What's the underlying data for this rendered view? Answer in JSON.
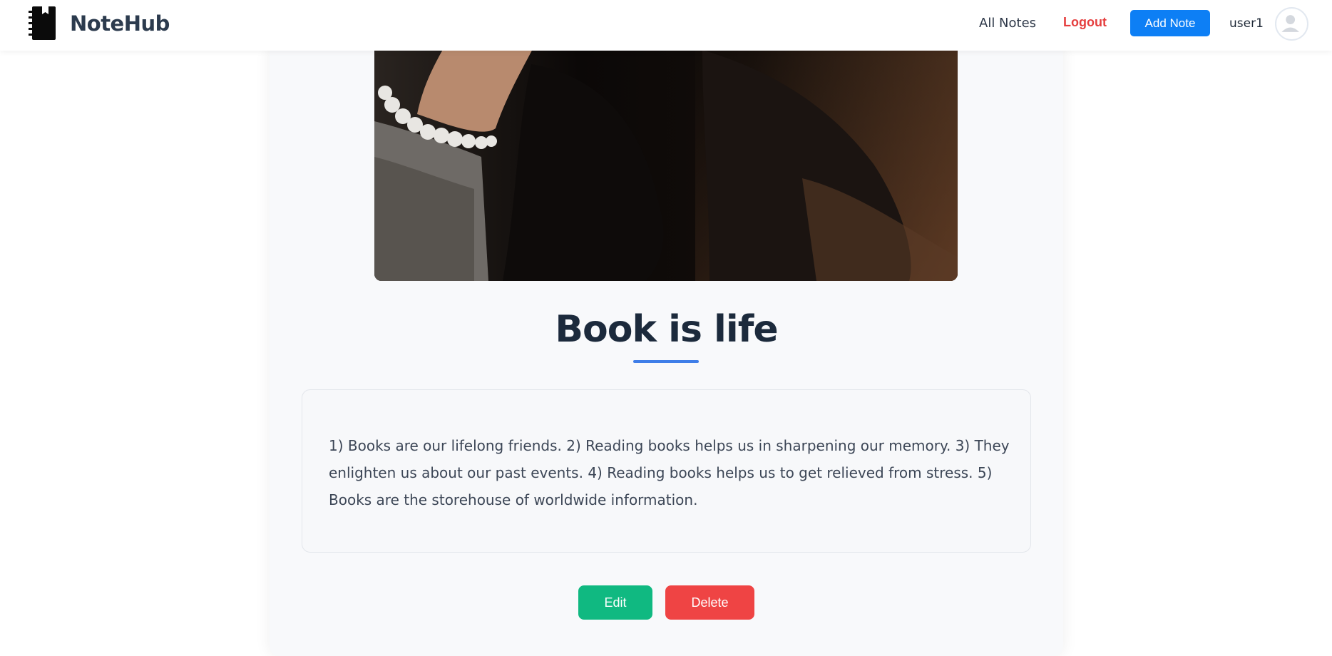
{
  "header": {
    "brand_name": "NoteHub",
    "brand_icon": "notebook-icon",
    "nav": {
      "all_notes": "All Notes",
      "logout": "Logout",
      "add_note": "Add Note"
    },
    "username": "user1",
    "avatar_icon": "user-avatar-icon"
  },
  "note": {
    "image_alt": "Person holding a book",
    "title": "Book is life",
    "content": "1) Books are our lifelong friends. 2) Reading books helps us in sharpening our memory. 3) They enlighten us about our past events. 4) Reading books helps us to get relieved from stress. 5) Books are the storehouse of worldwide information.",
    "actions": {
      "edit": "Edit",
      "delete": "Delete"
    }
  },
  "colors": {
    "accent_blue": "#0d7ff5",
    "logout_red": "#e53e3e",
    "edit_green": "#10b981",
    "delete_red": "#ef4444",
    "title_underline": "#3f7ee8"
  }
}
